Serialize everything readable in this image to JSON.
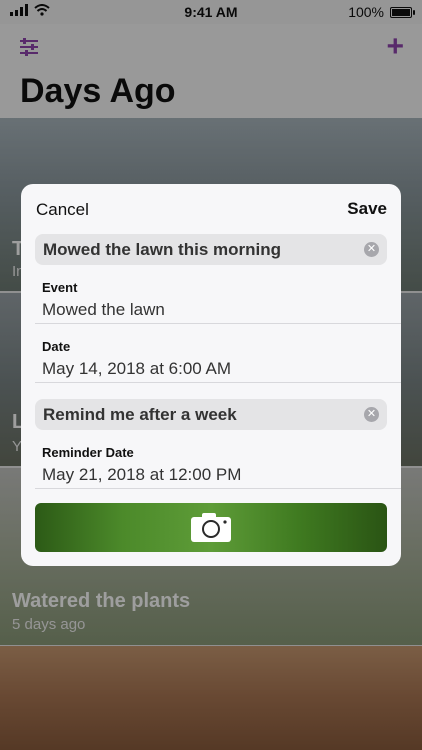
{
  "status_bar": {
    "time": "9:41 AM",
    "battery": "100%"
  },
  "nav": {
    "title": "Days Ago",
    "filter_icon": "sliders-icon",
    "add_icon": "plus-icon",
    "accent": "#8e44ad"
  },
  "list": {
    "card1": {
      "title": "T",
      "subtitle": "In"
    },
    "card2": {
      "title": "L",
      "subtitle": "Y"
    },
    "card3": {
      "title": "Watered the plants",
      "subtitle": "5 days ago"
    }
  },
  "modal": {
    "cancel_label": "Cancel",
    "save_label": "Save",
    "name_field": {
      "value": "Mowed the lawn this morning"
    },
    "event": {
      "label": "Event",
      "value": "Mowed the lawn"
    },
    "date": {
      "label": "Date",
      "value": "May 14, 2018 at 6:00 AM"
    },
    "reminder_field": {
      "value": "Remind me after a week"
    },
    "reminder_date": {
      "label": "Reminder Date",
      "value": "May 21, 2018 at 12:00 PM"
    },
    "photo_icon": "camera-icon"
  }
}
